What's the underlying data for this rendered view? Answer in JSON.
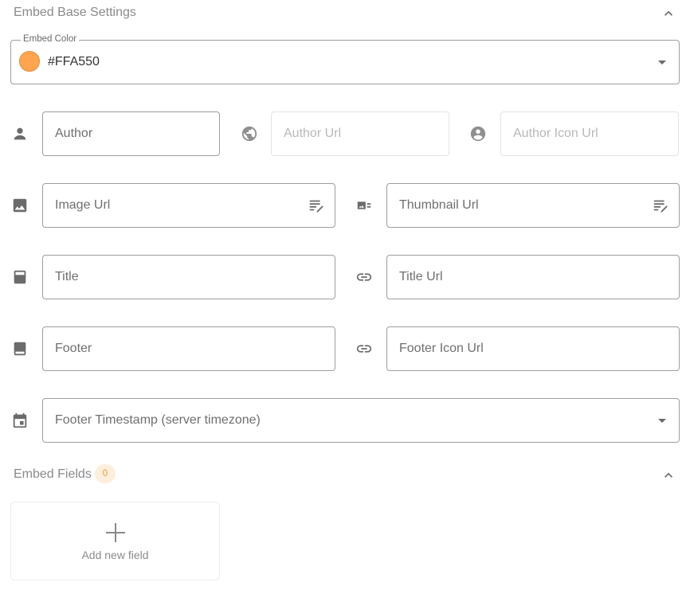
{
  "base_section": {
    "title": "Embed Base Settings"
  },
  "embed_color": {
    "legend": "Embed Color",
    "value": "#FFA550",
    "swatch_color": "#FFA550"
  },
  "fields": {
    "author": "Author",
    "author_url": "Author Url",
    "author_icon_url": "Author Icon Url",
    "image_url": "Image Url",
    "thumbnail_url": "Thumbnail Url",
    "title": "Title",
    "title_url": "Title Url",
    "footer": "Footer",
    "footer_icon_url": "Footer Icon Url",
    "footer_timestamp": "Footer Timestamp (server timezone)"
  },
  "icons": {
    "author": "person-icon",
    "author_url": "globe-icon",
    "author_icon_url": "account-circle-icon",
    "image_url": "image-icon",
    "thumbnail_url": "card-image-icon",
    "title": "title-icon",
    "title_url": "link-icon",
    "footer": "footer-icon",
    "footer_icon_url": "link-icon",
    "footer_timestamp": "calendar-icon",
    "edit": "edit-note-icon"
  },
  "fields_section": {
    "title": "Embed Fields",
    "count": "0"
  },
  "add_field": {
    "label": "Add new field"
  }
}
